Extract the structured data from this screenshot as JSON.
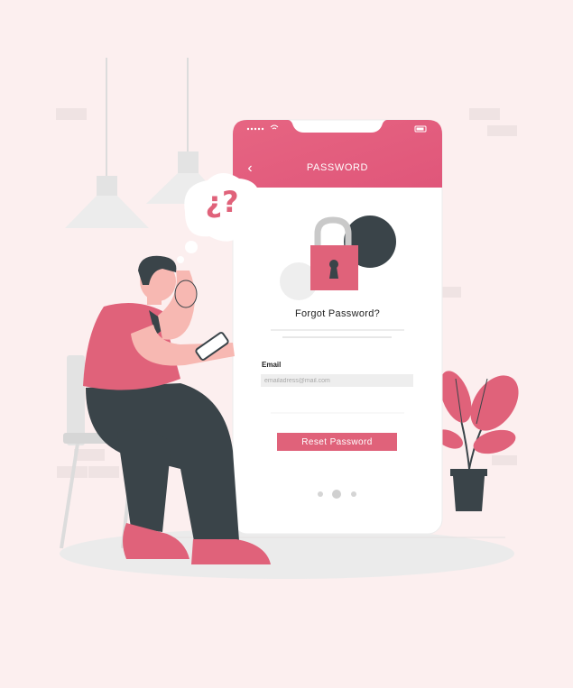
{
  "screen": {
    "header_title": "PASSWORD",
    "heading": "Forgot Password?",
    "email": {
      "label": "Email",
      "placeholder": "emailadress@mail.com"
    },
    "reset_button_label": "Reset Password",
    "pagination": {
      "pages": 3,
      "active_index": 1
    }
  },
  "thought_bubble_text": "¿?",
  "colors": {
    "background": "#fcefef",
    "accent_pink": "#e0627a",
    "dark_slate": "#3a4449",
    "skin": "#f7b8b2"
  }
}
